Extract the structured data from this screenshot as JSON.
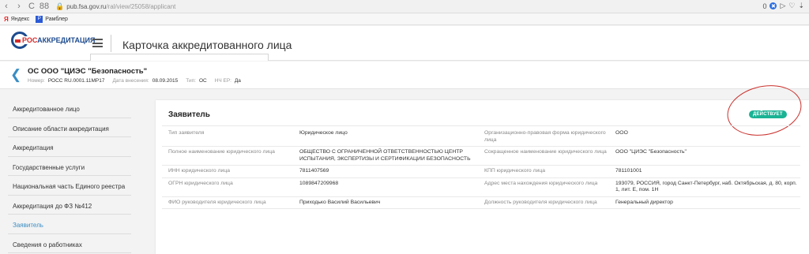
{
  "browser": {
    "back": "‹",
    "forward": "›",
    "reload": "C",
    "grid": "88",
    "url_domain": "pub.fsa.gov.ru",
    "url_path": "/ral/view/25058/applicant",
    "badge": "0"
  },
  "bookmarks": [
    {
      "icon": "Я",
      "label": "Яндекс"
    },
    {
      "icon": "Р",
      "label": "Рамблер"
    }
  ],
  "header": {
    "logo_prefix": "РОС",
    "logo_text": "АККРЕДИТАЦИЯ",
    "title": "Карточка аккредитованного лица"
  },
  "entity": {
    "name": "ОС ООО \"ЦИЭС \"Безопасность\"",
    "number_label": "Номер:",
    "number": "РОСС RU.0001.11МР17",
    "date_label": "Дата внесения:",
    "date": "08.09.2015",
    "type_label": "Тип:",
    "type": "ОС",
    "nch_label": "НЧ ЕР:",
    "nch": "Да"
  },
  "sidebar": {
    "items": [
      {
        "label": "Аккредитованное лицо"
      },
      {
        "label": "Описание области аккредитация"
      },
      {
        "label": "Аккредитация"
      },
      {
        "label": "Государственные услуги"
      },
      {
        "label": "Национальная часть Единого реестра"
      },
      {
        "label": "Аккредитация до ФЗ №412"
      },
      {
        "label": "Заявитель"
      },
      {
        "label": "Сведения о работниках"
      }
    ],
    "active_index": 6
  },
  "card": {
    "title": "Заявитель",
    "status": "ДЕЙСТВУЕТ",
    "rows": [
      {
        "l1": "Тип заявителя",
        "v1": "Юридическое лицо",
        "l2": "Организационно-правовая форма юридического лица",
        "v2": "ООО"
      },
      {
        "l1": "Полное наименование юридического лица",
        "v1": "ОБЩЕСТВО С ОГРАНИЧЕННОЙ ОТВЕТСТВЕННОСТЬЮ ЦЕНТР ИСПЫТАНИЯ, ЭКСПЕРТИЗЫ И СЕРТИФИКАЦИИ БЕЗОПАСНОСТЬ",
        "l2": "Сокращенное наименование юридического лица",
        "v2": "ООО \"ЦИЭС \"Безопасность\""
      },
      {
        "l1": "ИНН юридического лица",
        "v1": "7811407569",
        "l2": "КПП юридического лица",
        "v2": "781101001"
      },
      {
        "l1": "ОГРН юридического лица",
        "v1": "1089847209968",
        "l2": "Адрес места нахождения юридического лица",
        "v2": "193079, РОССИЯ, город Санкт-Петербург, наб. Октябрьская, д. 80, корп. 1, лит. Е, пом. 1Н"
      },
      {
        "l1": "ФИО руководителя юридического лица",
        "v1": "Приходько Василий Васильевич",
        "l2": "Должность руководителя юридического лица",
        "v2": "Генеральный директор"
      }
    ]
  },
  "colors": {
    "accent": "#3a8dc4",
    "status_green": "#1ab394",
    "annotation_red": "#c9302c"
  }
}
